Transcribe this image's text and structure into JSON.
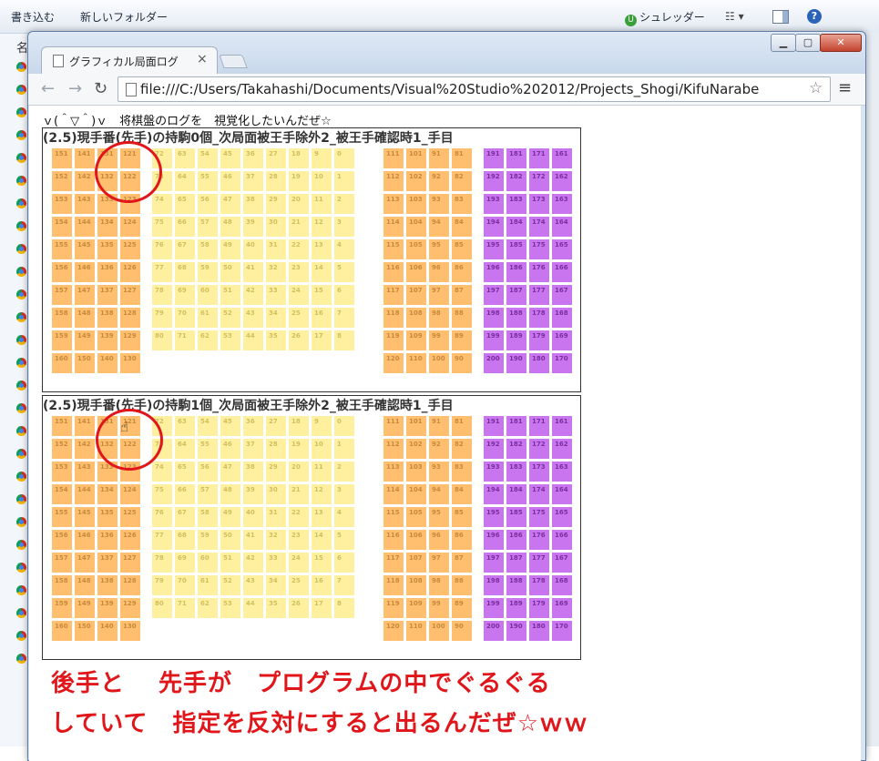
{
  "explorer": {
    "toolbar": {
      "burn_label": "書き込む",
      "new_folder_label": "新しいフォルダー",
      "shredder_label": "シュレッダー"
    },
    "column_header": "名"
  },
  "browser": {
    "tab_title": "グラフィカル局面ログ",
    "url": "file:///C:/Users/Takahashi/Documents/Visual%20Studio%202012/Projects_Shogi/KifuNarabe"
  },
  "page": {
    "heading": "ｖ(＾▽＾)ｖ　将棋盤のログを　視覚化したいんだぜ☆",
    "panels": [
      {
        "title": "(2.5)現手番(先手)の持駒0個_次局面被王手除外2_被王手確認時1_手目"
      },
      {
        "title": "(2.5)現手番(先手)の持駒1個_次局面被王手除外2_被王手確認時1_手目"
      }
    ],
    "note_lines": [
      "後手と　 先手が　プログラムの中でぐるぐる",
      "していて　指定を反対にすると出るんだぜ☆ｗｗ"
    ],
    "highlight_color": "#e0161a"
  },
  "board_colors": {
    "sente_hand": "#ffbf6e",
    "board": "#fff0a0",
    "gote_hand": "#c975f0"
  }
}
